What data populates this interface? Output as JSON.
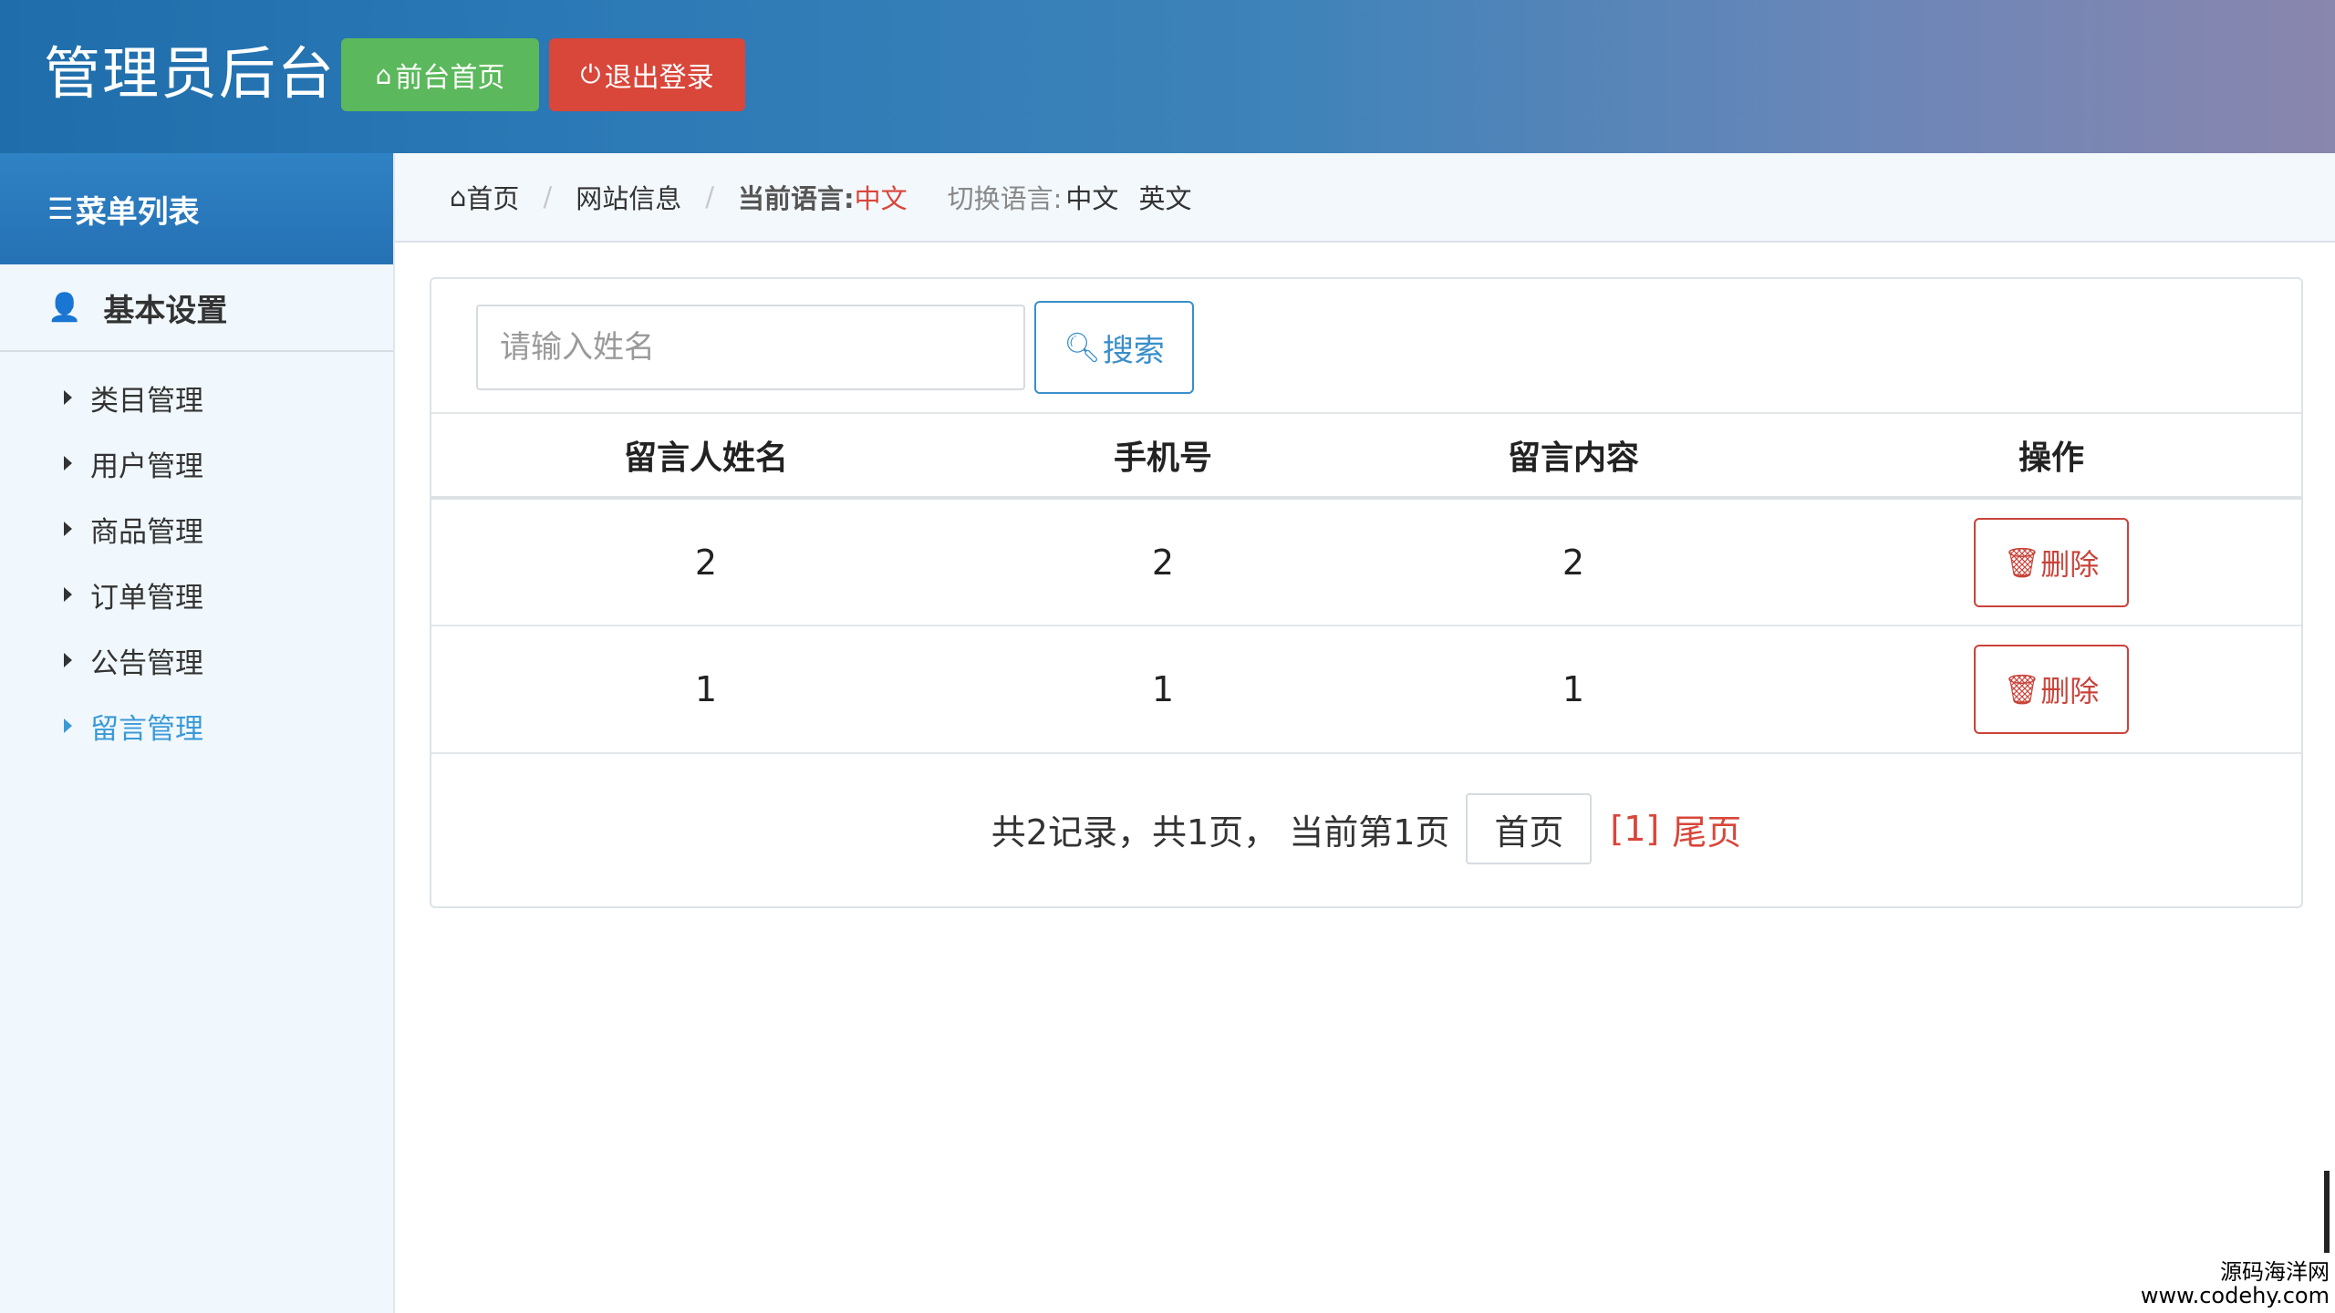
{
  "header": {
    "title": "管理员后台",
    "home_label": "前台首页",
    "logout_label": "退出登录",
    "home_color": "#5cb85c",
    "logout_color": "#d9463a"
  },
  "sidebar": {
    "title": "菜单列表",
    "group": "基本设置",
    "items": [
      {
        "label": "类目管理"
      },
      {
        "label": "用户管理"
      },
      {
        "label": "商品管理"
      },
      {
        "label": "订单管理"
      },
      {
        "label": "公告管理"
      },
      {
        "label": "留言管理",
        "active": true
      }
    ]
  },
  "breadcrumb": {
    "home": "首页",
    "page": "网站信息",
    "current_lang_label": "当前语言:",
    "current_lang": "中文",
    "switch_label": "切换语言:",
    "lang_cn": "中文",
    "lang_en": "英文"
  },
  "search": {
    "placeholder": "请输入姓名",
    "button": "搜索"
  },
  "table": {
    "headers": [
      "留言人姓名",
      "手机号",
      "留言内容",
      "操作"
    ],
    "rows": [
      {
        "name": "2",
        "phone": "2",
        "content": "2",
        "action": "删除"
      },
      {
        "name": "1",
        "phone": "1",
        "content": "1",
        "action": "删除"
      }
    ]
  },
  "pager": {
    "summary": "共2记录，共1页， 当前第1页",
    "first": "首页",
    "current": "[1]",
    "last": "尾页"
  },
  "watermark": {
    "line1": "源码海洋网",
    "line2": "www.codehy.com"
  }
}
